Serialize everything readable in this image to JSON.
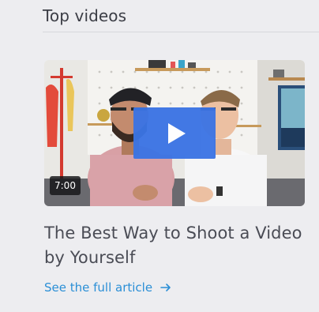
{
  "section": {
    "title": "Top videos"
  },
  "video": {
    "duration": "7:00",
    "title": "The Best Way to Shoot a Video by Yourself",
    "thumbnail_icon": "video-thumbnail",
    "play_icon": "play-icon"
  },
  "link": {
    "label": "See the full article",
    "icon": "arrow-right-icon",
    "color": "#2b8fd6"
  },
  "colors": {
    "background": "#ededf0",
    "play_button": "#3b74e4",
    "title_text": "#4a4c55"
  }
}
